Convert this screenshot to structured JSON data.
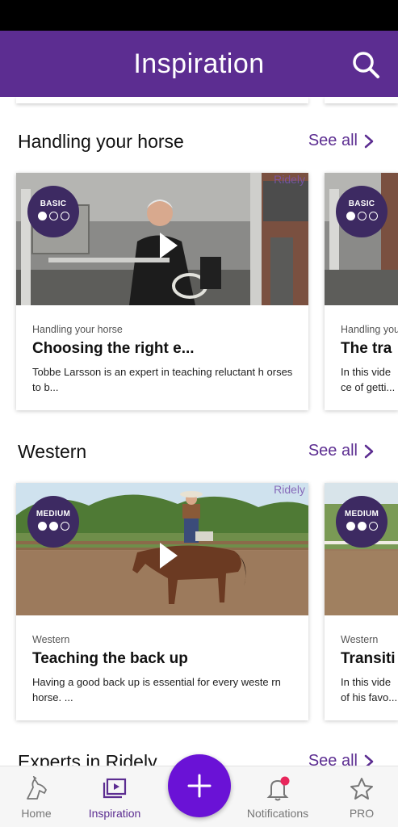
{
  "header": {
    "title": "Inspiration",
    "search_icon": "search-icon"
  },
  "sections": [
    {
      "title": "Handling your horse",
      "see_all": "See all",
      "cards": [
        {
          "level": "BASIC",
          "level_dots": 1,
          "watermark": "Ridely",
          "category": "Handling your horse",
          "title": "Choosing the right e...",
          "description": "Tobbe Larsson is an expert in teaching reluctant h orses to b..."
        },
        {
          "level": "BASIC",
          "level_dots": 1,
          "category": "Handling you",
          "title": "The tra",
          "description": "In this vide ce of getti..."
        }
      ]
    },
    {
      "title": "Western",
      "see_all": "See all",
      "cards": [
        {
          "level": "MEDIUM",
          "level_dots": 2,
          "watermark": "Ridely",
          "category": "Western",
          "title": "Teaching the back up",
          "description": "Having a good back up is essential for every weste rn horse. ..."
        },
        {
          "level": "MEDIUM",
          "level_dots": 2,
          "category": "Western",
          "title": "Transiti",
          "description": "In this vide of his favo..."
        }
      ]
    },
    {
      "title": "Experts in Ridely",
      "see_all": "See all"
    }
  ],
  "bottom_nav": {
    "items": [
      {
        "label": "Home",
        "icon": "horse-head-icon",
        "active": false
      },
      {
        "label": "Inspiration",
        "icon": "video-library-icon",
        "active": true
      },
      {
        "label": "Notifications",
        "icon": "bell-icon",
        "active": false,
        "has_badge": true
      },
      {
        "label": "PRO",
        "icon": "star-icon",
        "active": false
      }
    ],
    "add_button_icon": "plus-icon"
  },
  "colors": {
    "brand": "#5c2d91",
    "fab": "#6a12d6",
    "badge_bg": "#3d2a62",
    "notification_dot": "#e8265b"
  }
}
